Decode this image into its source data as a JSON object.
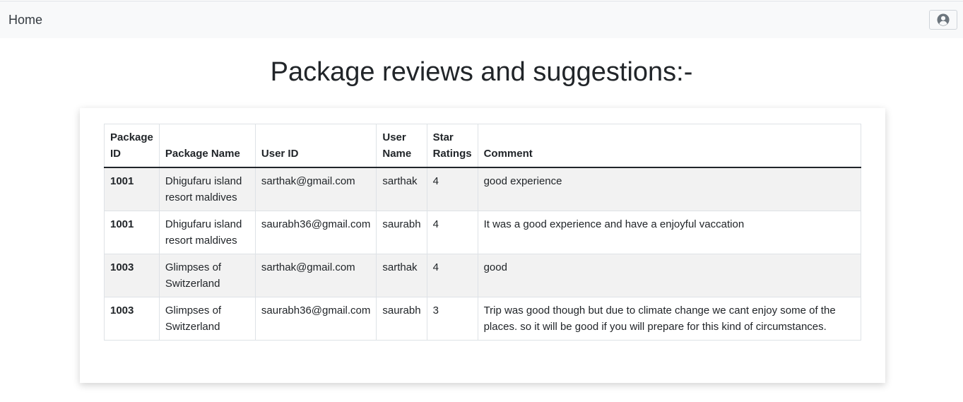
{
  "navbar": {
    "home_label": "Home",
    "user_icon": "user-circle-icon"
  },
  "page": {
    "title": "Package reviews and suggestions:-"
  },
  "table": {
    "headers": {
      "package_id": "Package ID",
      "package_name": "Package Name",
      "user_id": "User ID",
      "user_name": "User Name",
      "star_ratings": "Star Ratings",
      "comment": "Comment"
    },
    "rows": [
      {
        "package_id": "1001",
        "package_name": "Dhigufaru island resort maldives",
        "user_id": "sarthak@gmail.com",
        "user_name": "sarthak",
        "star_ratings": "4",
        "comment": "good experience"
      },
      {
        "package_id": "1001",
        "package_name": "Dhigufaru island resort maldives",
        "user_id": "saurabh36@gmail.com",
        "user_name": "saurabh",
        "star_ratings": "4",
        "comment": "It was a good experience and have a enjoyful vaccation"
      },
      {
        "package_id": "1003",
        "package_name": "Glimpses of Switzerland",
        "user_id": "sarthak@gmail.com",
        "user_name": "sarthak",
        "star_ratings": "4",
        "comment": "good"
      },
      {
        "package_id": "1003",
        "package_name": "Glimpses of Switzerland",
        "user_id": "saurabh36@gmail.com",
        "user_name": "saurabh",
        "star_ratings": "3",
        "comment": "Trip was good though but due to climate change we cant enjoy some of the places. so it will be good if you will prepare for this kind of circumstances."
      }
    ]
  },
  "colors": {
    "navbar_bg": "#f8f9fa",
    "striped_row_bg": "#f2f2f2",
    "text": "#212529"
  }
}
